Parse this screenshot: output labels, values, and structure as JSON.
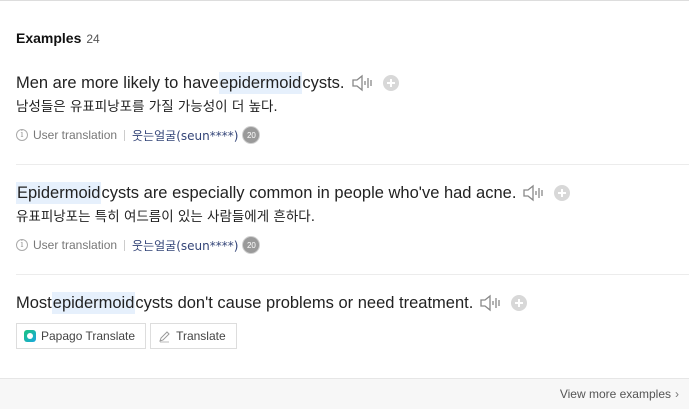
{
  "header": {
    "title": "Examples",
    "count": "24"
  },
  "examples": [
    {
      "en_before": "Men are more likely to have ",
      "en_highlight": "epidermoid",
      "en_after": " cysts.",
      "ko": "남성들은 유표피낭포를 가질 가능성이 더 높다.",
      "source": "User translation",
      "user": "웃는얼굴(seun****)",
      "level": "20"
    },
    {
      "en_before": "",
      "en_highlight": "Epidermoid",
      "en_after": " cysts are especially common in people who've had acne.",
      "ko": "유표피낭포는 특히 여드름이 있는 사람들에게 흔하다.",
      "source": "User translation",
      "user": "웃는얼굴(seun****)",
      "level": "20"
    },
    {
      "en_before": "Most ",
      "en_highlight": "epidermoid",
      "en_after": " cysts don't cause problems or need treatment."
    }
  ],
  "buttons": {
    "papago": "Papago Translate",
    "translate": "Translate"
  },
  "footer": {
    "more": "View more examples"
  },
  "icons": {
    "speaker": "speaker-icon",
    "add": "plus-icon",
    "info": "info-icon",
    "papago": "papago-logo-icon",
    "pencil": "pencil-icon",
    "chevron": "chevron-right-icon"
  },
  "colors": {
    "highlight": "#e6f0fc",
    "user_link": "#334477",
    "footer_bg": "#f7f7f7"
  }
}
